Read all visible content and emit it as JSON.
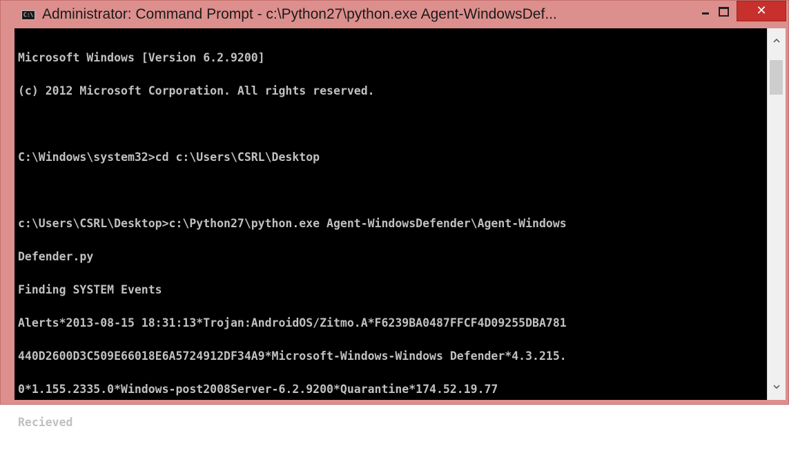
{
  "window": {
    "title": "Administrator: Command Prompt - c:\\Python27\\python.exe  Agent-WindowsDef...",
    "icon": "cmd-icon",
    "controls": {
      "minimize": "minimize-icon",
      "maximize": "maximize-icon",
      "close": "✕"
    }
  },
  "console": {
    "lines": [
      "Microsoft Windows [Version 6.2.9200]",
      "(c) 2012 Microsoft Corporation. All rights reserved.",
      "",
      "C:\\Windows\\system32>cd c:\\Users\\CSRL\\Desktop",
      "",
      "c:\\Users\\CSRL\\Desktop>c:\\Python27\\python.exe Agent-WindowsDefender\\Agent-Windows",
      "Defender.py",
      "Finding SYSTEM Events",
      "Alerts*2013-08-15 18:31:13*Trojan:AndroidOS/Zitmo.A*F6239BA0487FFCF4D09255DBA781",
      "440D2600D3C509E66018E6A5724912DF34A9*Microsoft-Windows-Windows Defender*4.3.215.",
      "0*1.155.2335.0*Windows-post2008Server-6.2.9200*Quarantine*174.52.19.77",
      "Recieved"
    ]
  },
  "colors": {
    "frame": "#dd8f8d",
    "close_button": "#c7302c",
    "console_bg": "#000000",
    "console_text": "#c0c0c0"
  }
}
